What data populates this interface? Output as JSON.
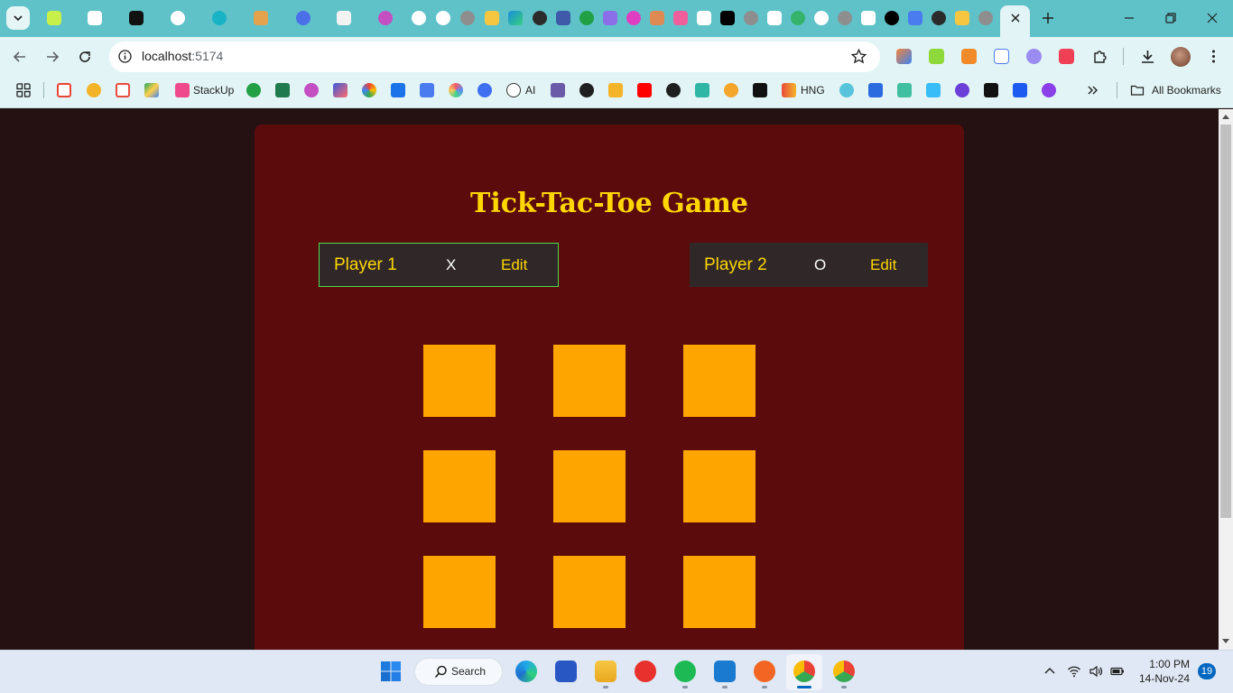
{
  "browser": {
    "url_host": "localhost",
    "url_port": ":5174",
    "pinned_tab_icons": [
      "trading-icon",
      "trend-icon",
      "terminal-icon",
      "openai-icon",
      "bulb-icon",
      "dma-icon",
      "shield-icon",
      "avatar-icon",
      "react-icon",
      "trend-icon",
      "trend-icon",
      "globe-icon",
      "bulb-icon",
      "nebula-icon",
      "github-icon",
      "code-icon",
      "badge-86-icon",
      "link-icon",
      "dot-icon",
      "brush-icon",
      "pink-icon",
      "gmail-icon",
      "x-icon",
      "globe-icon",
      "css-icon",
      "wave-icon",
      "google-icon",
      "globe-icon",
      "notion-icon",
      "triangle-icon",
      "docs-icon",
      "github-icon",
      "bulb-icon",
      "globe-icon"
    ],
    "extension_icons": [
      "pencil-icon",
      "leaf-icon",
      "fox-icon",
      "phone-icon",
      "cloud-icon",
      "pocket-icon"
    ],
    "bookmarks": [
      {
        "icon": "apps-icon",
        "label": ""
      },
      {
        "icon": "gmail-icon",
        "label": ""
      },
      {
        "icon": "bitcoin-icon",
        "label": ""
      },
      {
        "icon": "calendar-icon",
        "label": ""
      },
      {
        "icon": "drive-icon",
        "label": ""
      },
      {
        "icon": "stackup-icon",
        "label": "StackUp"
      },
      {
        "icon": "badge-86-icon",
        "label": ""
      },
      {
        "icon": "webflow-icon",
        "label": ""
      },
      {
        "icon": "react-icon",
        "label": ""
      },
      {
        "icon": "gem-icon",
        "label": ""
      },
      {
        "icon": "chrome-icon",
        "label": ""
      },
      {
        "icon": "flag-icon",
        "label": ""
      },
      {
        "icon": "docs-icon",
        "label": ""
      },
      {
        "icon": "swirl-icon",
        "label": ""
      },
      {
        "icon": "c-icon",
        "label": ""
      },
      {
        "icon": "openai-icon",
        "label": "AI"
      },
      {
        "icon": "robot-icon",
        "label": ""
      },
      {
        "icon": "globe-icon",
        "label": ""
      },
      {
        "icon": "stack-icon",
        "label": ""
      },
      {
        "icon": "youtube-icon",
        "label": ""
      },
      {
        "icon": "github-icon",
        "label": ""
      },
      {
        "icon": "v-icon",
        "label": ""
      },
      {
        "icon": "g-icon",
        "label": ""
      },
      {
        "icon": "r-icon",
        "label": ""
      },
      {
        "icon": "hng-icon",
        "label": "HNG"
      },
      {
        "icon": "react-icon",
        "label": ""
      },
      {
        "icon": "heart-icon",
        "label": ""
      },
      {
        "icon": "d-icon",
        "label": ""
      },
      {
        "icon": "tailwind-icon",
        "label": ""
      },
      {
        "icon": "u-icon",
        "label": ""
      },
      {
        "icon": "bolt-icon",
        "label": ""
      },
      {
        "icon": "behance-icon",
        "label": ""
      },
      {
        "icon": "s-icon",
        "label": ""
      }
    ],
    "all_bookmarks_label": "All Bookmarks"
  },
  "game": {
    "title": "Tick-Tac-Toe Game",
    "players": [
      {
        "name": "Player 1",
        "symbol": "X",
        "edit_label": "Edit",
        "active": true
      },
      {
        "name": "Player 2",
        "symbol": "O",
        "edit_label": "Edit",
        "active": false
      }
    ],
    "board": [
      [
        "",
        "",
        ""
      ],
      [
        "",
        "",
        ""
      ],
      [
        "",
        "",
        ""
      ]
    ],
    "colors": {
      "page_bg": "#251112",
      "card_bg": "#5c0b0c",
      "title": "#ffd700",
      "cell": "#ffa500",
      "player_box": "#302828",
      "active_border": "#4ddc4d"
    }
  },
  "taskbar": {
    "search_label": "Search",
    "apps": [
      "edge-icon",
      "store-icon",
      "explorer-icon",
      "wps-icon",
      "spotify-icon",
      "vscode-icon",
      "pen-icon",
      "chrome-icon",
      "chrome-profile-icon"
    ],
    "time": "1:00 PM",
    "date": "14-Nov-24",
    "notification_count": "19"
  }
}
